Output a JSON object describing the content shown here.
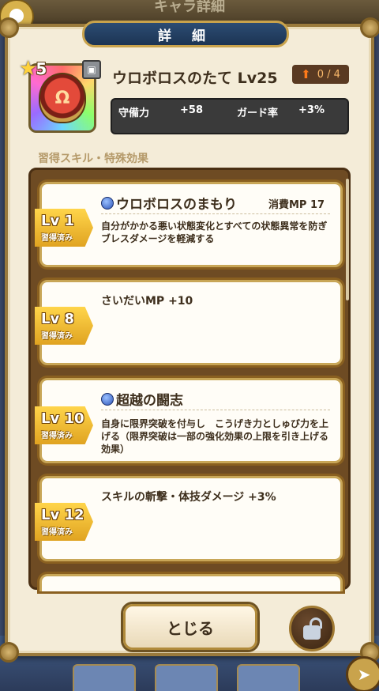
{
  "background": {
    "title": "キャラ詳細"
  },
  "dialog": {
    "title": "詳 細"
  },
  "item": {
    "rarity": "5",
    "name": "ウロボロスのたて Lv25",
    "upgrade": "0 / 4",
    "stats": [
      {
        "label": "守備力",
        "value": "+58"
      },
      {
        "label": "ガード率",
        "value": "+3%"
      }
    ]
  },
  "section_label": "習得スキル・特殊効果",
  "skills": [
    {
      "level": "Lv 1",
      "learned": "習得済み",
      "title": "ウロボロスのまもり",
      "mp": "消費MP 17",
      "desc": "自分がかかる悪い状態変化とすべての状態異常を防ぎ　ブレスダメージを軽減する"
    },
    {
      "level": "Lv 8",
      "learned": "習得済み",
      "text": "さいだいMP +10"
    },
    {
      "level": "Lv 10",
      "learned": "習得済み",
      "title": "超越の闘志",
      "desc": "自身に限界突破を付与し　こうげき力としゅび力を上げる（限界突破は一部の強化効果の上限を引き上げる効果）"
    },
    {
      "level": "Lv 12",
      "learned": "習得済み",
      "text": "スキルの斬撃・体技ダメージ +3%"
    }
  ],
  "buttons": {
    "close": "とじる"
  }
}
